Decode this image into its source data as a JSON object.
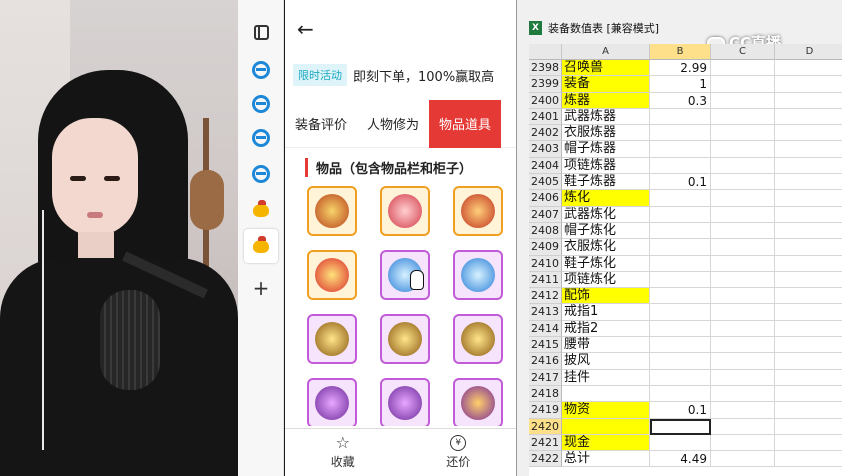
{
  "shop": {
    "promo_tag": "限时活动",
    "promo_text": "即刻下单，100%赢取高",
    "tabs": [
      "装备评价",
      "人物修为",
      "物品道具"
    ],
    "section_title": "物品（包含物品栏和柜子）",
    "bottom": {
      "collect": "收藏",
      "bargain": "还价",
      "bargain_icon": "¥"
    }
  },
  "excel": {
    "title": "装备数值表 [兼容模式]",
    "xl_badge": "X",
    "watermark": "CC直播",
    "columns": [
      "A",
      "B",
      "C",
      "D"
    ],
    "rows": [
      {
        "n": "2398",
        "a": "召唤兽",
        "b": "2.99",
        "hl": true
      },
      {
        "n": "2399",
        "a": "装备",
        "b": "1",
        "hl": true
      },
      {
        "n": "2400",
        "a": "炼器",
        "b": "0.3",
        "hl": true
      },
      {
        "n": "2401",
        "a": "武器炼器",
        "b": ""
      },
      {
        "n": "2402",
        "a": "衣服炼器",
        "b": ""
      },
      {
        "n": "2403",
        "a": "帽子炼器",
        "b": ""
      },
      {
        "n": "2404",
        "a": "项链炼器",
        "b": ""
      },
      {
        "n": "2405",
        "a": "鞋子炼器",
        "b": "0.1"
      },
      {
        "n": "2406",
        "a": "炼化",
        "b": "",
        "hl": true
      },
      {
        "n": "2407",
        "a": "武器炼化",
        "b": ""
      },
      {
        "n": "2408",
        "a": "帽子炼化",
        "b": ""
      },
      {
        "n": "2409",
        "a": "衣服炼化",
        "b": ""
      },
      {
        "n": "2410",
        "a": "鞋子炼化",
        "b": ""
      },
      {
        "n": "2411",
        "a": "项链炼化",
        "b": ""
      },
      {
        "n": "2412",
        "a": "配饰",
        "b": "",
        "hl": true
      },
      {
        "n": "2413",
        "a": "戒指1",
        "b": ""
      },
      {
        "n": "2414",
        "a": "戒指2",
        "b": ""
      },
      {
        "n": "2415",
        "a": "腰带",
        "b": ""
      },
      {
        "n": "2416",
        "a": "披风",
        "b": ""
      },
      {
        "n": "2417",
        "a": "挂件",
        "b": ""
      },
      {
        "n": "2418",
        "a": "",
        "b": ""
      },
      {
        "n": "2419",
        "a": "物资",
        "b": "0.1",
        "hl": true
      },
      {
        "n": "2420",
        "a": "",
        "b": "",
        "hl": true,
        "selected": true
      },
      {
        "n": "2421",
        "a": "现金",
        "b": "",
        "hl": true
      },
      {
        "n": "2422",
        "a": "总计",
        "b": "4.49"
      }
    ]
  }
}
